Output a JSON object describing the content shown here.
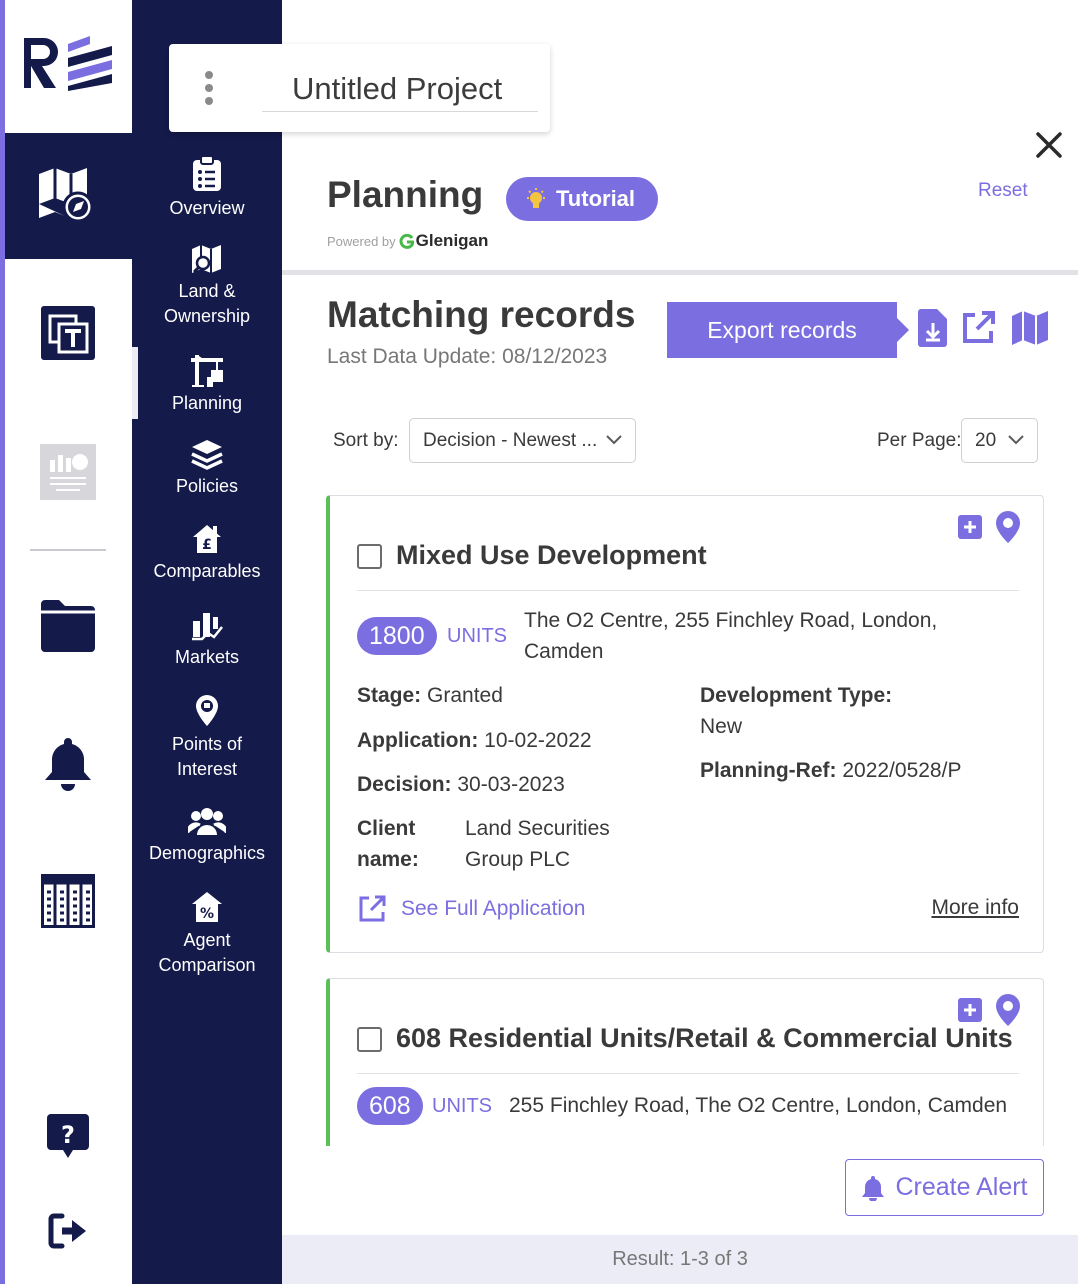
{
  "project": {
    "title": "Untitled Project"
  },
  "nav": {
    "items": [
      {
        "label": "Overview",
        "icon": "clipboard-list-icon"
      },
      {
        "label": "Land &\nOwnership",
        "icon": "map-search-icon"
      },
      {
        "label": "Planning",
        "icon": "crane-icon"
      },
      {
        "label": "Policies",
        "icon": "layers-icon"
      },
      {
        "label": "Comparables",
        "icon": "house-pound-icon"
      },
      {
        "label": "Markets",
        "icon": "market-chart-icon"
      },
      {
        "label": "Points of\nInterest",
        "icon": "map-pin-icon"
      },
      {
        "label": "Demographics",
        "icon": "people-icon"
      },
      {
        "label": "Agent\nComparison",
        "icon": "house-percent-icon"
      }
    ]
  },
  "header": {
    "title": "Planning",
    "tutorial_label": "Tutorial",
    "reset_label": "Reset",
    "powered_by": "Powered by",
    "powered_brand": "Glenigan"
  },
  "records": {
    "title": "Matching records",
    "last_update": "Last Data Update: 08/12/2023",
    "export_label": "Export records",
    "sort_label": "Sort by:",
    "sort_value": "Decision - Newest ...",
    "per_page_label": "Per Page:",
    "per_page_value": "20"
  },
  "cards": [
    {
      "title": "Mixed Use Development",
      "units": "1800",
      "units_word": "UNITS",
      "address": "The O2 Centre, 255 Finchley Road, London, Camden",
      "stage_label": "Stage:",
      "stage": "Granted",
      "application_label": "Application:",
      "application": "10-02-2022",
      "decision_label": "Decision:",
      "decision": "30-03-2023",
      "client_label": "Client name:",
      "client": "Land Securities Group PLC",
      "dev_type_label": "Development Type:",
      "dev_type": "New",
      "ref_label": "Planning-Ref:",
      "ref": "2022/0528/P",
      "see_full": "See Full Application",
      "more_info": "More info"
    },
    {
      "title": "608 Residential Units/Retail & Commercial Units",
      "units": "608",
      "units_word": "UNITS",
      "address": "255 Finchley Road, The O2 Centre, London, Camden"
    }
  ],
  "create_alert_label": "Create Alert",
  "footer": {
    "result": "Result: 1-3 of 3"
  },
  "colors": {
    "accent": "#7b6ee0",
    "navy": "#141a4a",
    "card_border": "#5cbf5a"
  }
}
